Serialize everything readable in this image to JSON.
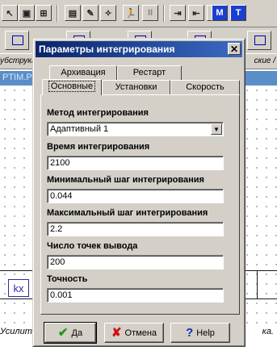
{
  "background": {
    "tab_strip_left": "убструкт",
    "tab_strip_right": "ские /",
    "doc_title": "PTIM.P",
    "block_label": "kx",
    "bottom_caption_left": "Усилите",
    "bottom_caption_right": "ка.",
    "toolbar_icons": [
      "pointer-icon",
      "layout-icon",
      "grid-icon",
      "calc-icon",
      "paint-icon",
      "run-icon",
      "run-figure-icon",
      "pause-icon",
      "block-in-icon",
      "block-out-icon",
      "m-icon",
      "t-icon"
    ],
    "toolbar_letters": {
      "pause": "II",
      "m": "M",
      "t": "T"
    }
  },
  "dialog": {
    "title": "Параметры интегрирования",
    "close_glyph": "✕",
    "tabs_back": [
      "Архивация",
      "Рестарт"
    ],
    "tabs_front": [
      "Основные",
      "Установки",
      "Скорость"
    ],
    "active_tab": "Основные",
    "fields": {
      "method_label": "Метод интегрирования",
      "method_value": "Адаптивный 1",
      "time_label": "Время интегрирования",
      "time_value": "2100",
      "min_step_label": "Минимальный шаг интегрирования",
      "min_step_value": "0.044",
      "max_step_label": "Максимальный шаг интегрирования",
      "max_step_value": "2.2",
      "points_label": "Число точек вывода",
      "points_value": "200",
      "accuracy_label": "Точность",
      "accuracy_value": "0.001"
    },
    "buttons": {
      "ok": "Да",
      "cancel": "Отмена",
      "help": "Help"
    },
    "colors": {
      "title_start": "#0a246a",
      "title_end": "#3b6bc4",
      "ok_icon": "#1a9a1a",
      "cancel_icon": "#cc1010",
      "help_icon": "#1030b0"
    }
  }
}
